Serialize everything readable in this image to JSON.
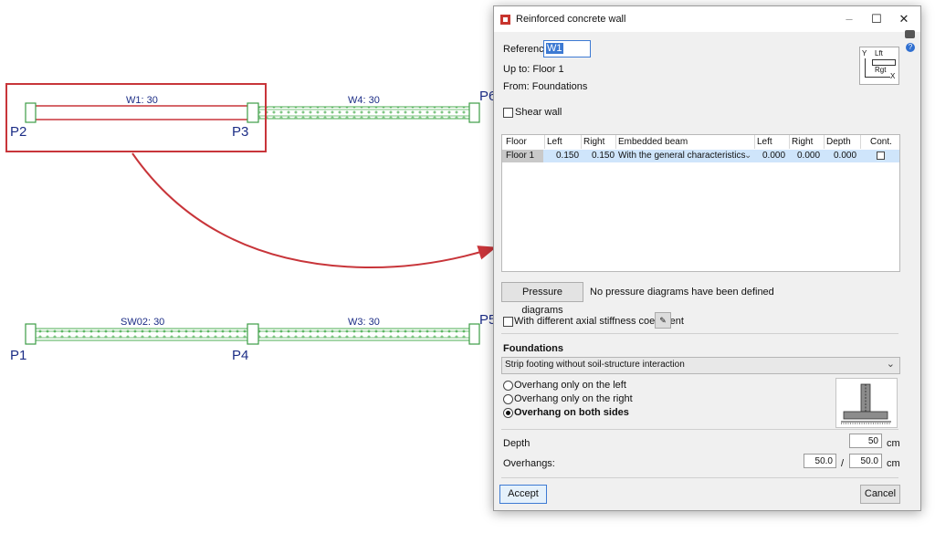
{
  "plan": {
    "nodes": [
      "P1",
      "P2",
      "P3",
      "P4",
      "P5",
      "P6"
    ],
    "walls": [
      "W1: 30",
      "W4: 30",
      "SW02: 30",
      "W3: 30"
    ]
  },
  "dialog": {
    "title": "Reinforced concrete wall",
    "reference_label": "Reference",
    "reference_value": "W1",
    "up_to": "Up to: Floor 1",
    "from": "From:  Foundations",
    "axes_lft": "Lft",
    "axes_rgt": "Rgt",
    "axes_x": "X",
    "axes_y": "Y",
    "shear_wall_label": "Shear wall",
    "table": {
      "headers": [
        "Floor",
        "Left",
        "Right",
        "Embedded beam",
        "Left",
        "Right",
        "Depth",
        "Cont."
      ],
      "row": {
        "floor": "Floor 1",
        "left": "0.150",
        "right": "0.150",
        "beam": "With the general characteristics",
        "left2": "0.000",
        "right2": "0.000",
        "depth": "0.000"
      }
    },
    "pressure_button": "Pressure diagrams",
    "pressure_status": "No pressure diagrams have been defined",
    "axial_label": "With different axial stiffness coefficient",
    "foundations_heading": "Foundations",
    "foundation_type": "Strip footing without soil-structure interaction",
    "options": [
      "Overhang only on the left",
      "Overhang only on the right",
      "Overhang on both sides"
    ],
    "selected_option": 2,
    "depth_label": "Depth",
    "depth_value": "50",
    "depth_unit": "cm",
    "overhangs_label": "Overhangs:",
    "overhang_left": "50.0",
    "overhang_sep": "/",
    "overhang_right": "50.0",
    "overhang_unit": "cm",
    "accept": "Accept",
    "cancel": "Cancel"
  },
  "colors": {
    "label_blue": "#1c2d86",
    "selection_red": "#c8353a",
    "wall_green": "#4cae53"
  }
}
